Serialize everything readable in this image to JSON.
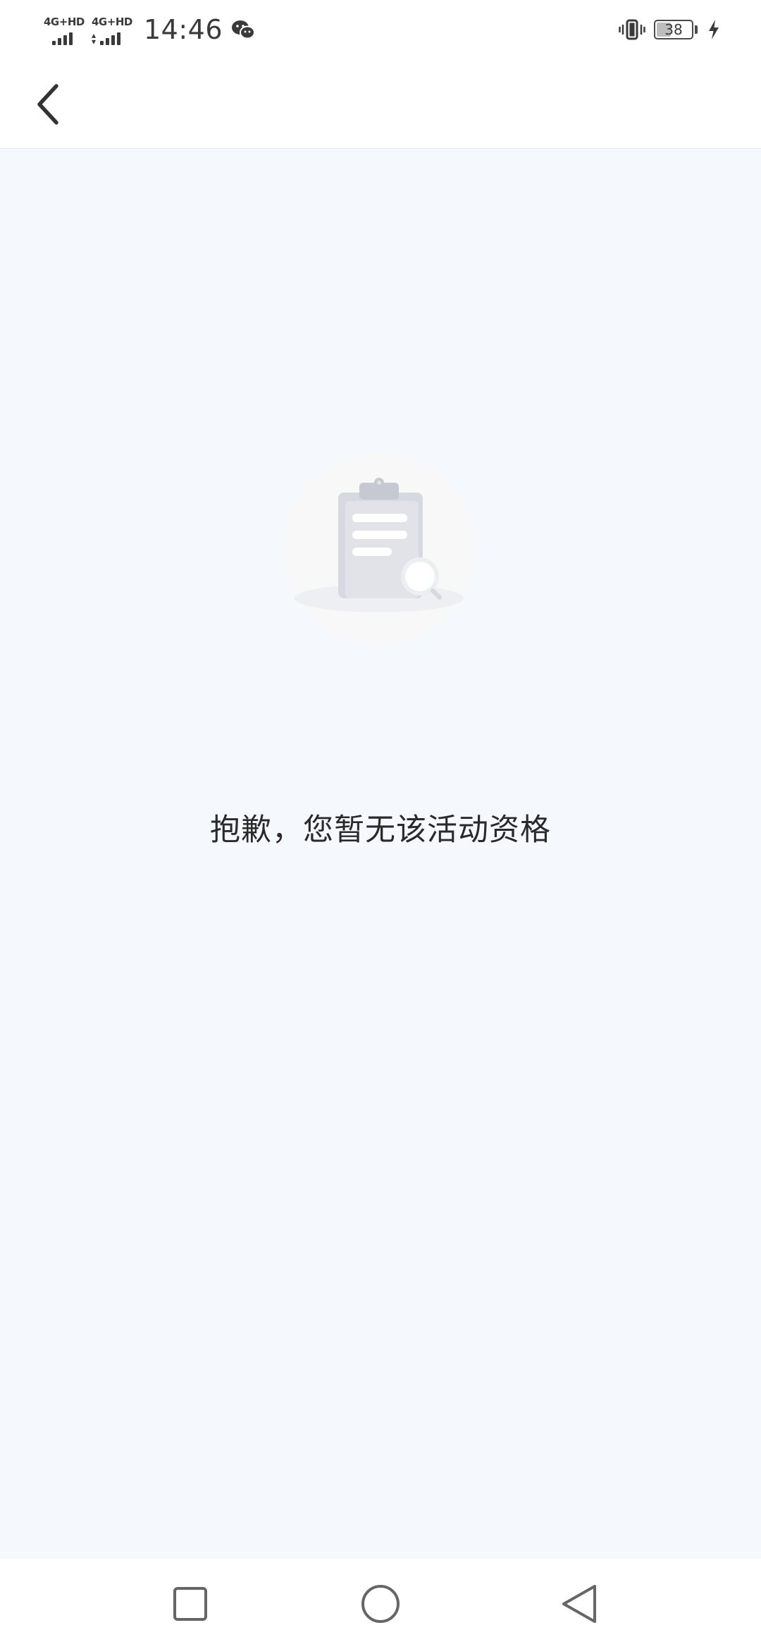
{
  "status_bar": {
    "sim1_tech": "4G+HD",
    "sim2_tech": "4G+HD",
    "time": "14:46",
    "battery_percent": "38",
    "battery_level": 0.38,
    "icons": [
      "signal-icon",
      "wechat-icon",
      "vibrate-icon",
      "battery-icon",
      "charging-icon"
    ]
  },
  "header": {
    "back_icon": "chevron-left-icon"
  },
  "empty_state": {
    "illustration": "clipboard-search-icon",
    "message": "抱歉，您暂无该活动资格"
  },
  "nav_bar": {
    "recent_icon": "square-icon",
    "home_icon": "circle-icon",
    "back_icon": "triangle-back-icon"
  },
  "colors": {
    "page_background": "#f5f8fd",
    "bar_background": "#ffffff",
    "text": "#2a2a2a",
    "icon": "#3a3a3a"
  }
}
